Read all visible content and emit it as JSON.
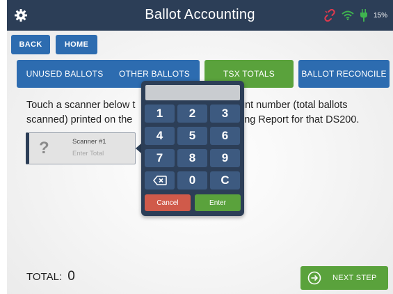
{
  "window": {
    "title": "Ballot Accounting",
    "battery_percent": "15%",
    "icons": [
      "gear-icon",
      "connection-broken-icon",
      "wifi-icon",
      "power-plug-icon"
    ]
  },
  "nav": {
    "back_label": "BACK",
    "home_label": "HOME"
  },
  "tabs": [
    {
      "label": "UNUSED BALLOTS",
      "active": false
    },
    {
      "label": "OTHER BALLOTS",
      "active": false
    },
    {
      "label": "TSX TOTALS",
      "active": true
    },
    {
      "label": "BALLOT RECONCILE",
      "active": false
    }
  ],
  "instructions": {
    "line1_left": "Touch a scanner below t",
    "line1_right": "unt number (total ballots",
    "line2_left": "scanned) printed on the",
    "line2_right": "ing Report for that DS200."
  },
  "scanner": {
    "status_glyph": "?",
    "name": "Scanner #1",
    "placeholder": "Enter Total"
  },
  "keypad": {
    "display_value": "",
    "keys": [
      "1",
      "2",
      "3",
      "4",
      "5",
      "6",
      "7",
      "8",
      "9",
      "⌫",
      "0",
      "C"
    ],
    "cancel_label": "Cancel",
    "enter_label": "Enter"
  },
  "footer": {
    "total_label": "TOTAL:",
    "total_value": "0",
    "next_label": "NEXT STEP"
  },
  "colors": {
    "header": "#2c3e57",
    "primary_button": "#2d6cb0",
    "active_tab": "#5aa23c",
    "cancel": "#d05a4a",
    "enter": "#5aa23c",
    "broken_link": "#e0394e",
    "wifi": "#3fb34f",
    "plug": "#3fb34f"
  }
}
